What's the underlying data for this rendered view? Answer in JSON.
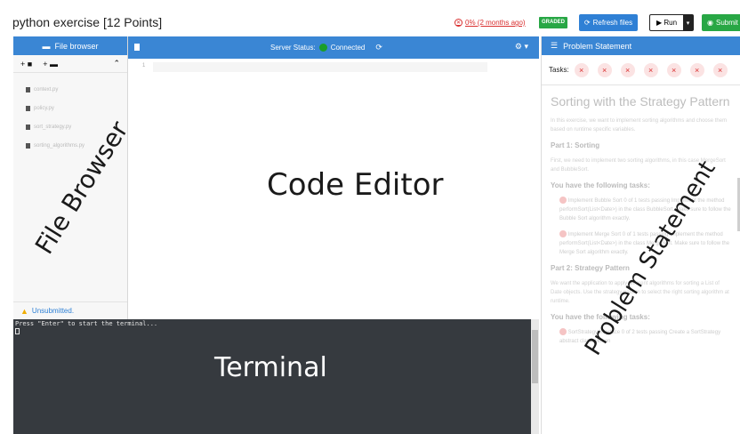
{
  "header": {
    "title": "python exercise",
    "points": "[12 Points]",
    "result_text": "0% (2 months ago)",
    "graded_badge": "GRADED",
    "refresh_label": "Refresh files",
    "run_label": "Run",
    "submit_label": "Submit"
  },
  "file_browser": {
    "title": "File browser",
    "add_file": "+",
    "add_folder": "+",
    "files": [
      "context.py",
      "policy.py",
      "sort_strategy.py",
      "sorting_algorithms.py"
    ],
    "status": "Unsubmitted."
  },
  "editor": {
    "server_status_label": "Server Status:",
    "connection": "Connected",
    "line_number": "1"
  },
  "terminal": {
    "prompt": "Press \"Enter\" to start the terminal..."
  },
  "problem": {
    "panel_title": "Problem Statement",
    "tasks_label": "Tasks:",
    "tasks": [
      "×",
      "×",
      "×",
      "×",
      "×",
      "×",
      "×"
    ],
    "heading": "Sorting with the Strategy Pattern",
    "intro": "In this exercise, we want to implement sorting algorithms and choose them based on runtime specific variables.",
    "part1": "Part 1: Sorting",
    "part1_text": "First, we need to implement two sorting algorithms, in this case MergeSort and BubbleSort.",
    "tasks_heading": "You have the following tasks:",
    "task1": "Implement Bubble Sort 0 of 1 tests passing Implement the method performSort(List<Date>) in the class BubbleSort. Make sure to follow the Bubble Sort algorithm exactly.",
    "task2": "Implement Merge Sort 0 of 1 tests passing Implement the method performSort(List<Date>) in the class MergeSort. Make sure to follow the Merge Sort algorithm exactly.",
    "part2": "Part 2: Strategy Pattern",
    "part2_text": "We want the application to apply different algorithms for sorting a List of Date objects. Use the strategy pattern to select the right sorting algorithm at runtime.",
    "tasks_heading2": "You have the following tasks:",
    "task3": "SortStrategy Interface 0 of 2 tests passing Create a SortStrategy abstract class with an"
  },
  "overlays": {
    "file_browser": "File Browser",
    "code_editor": "Code Editor",
    "terminal": "Terminal",
    "problem_statement": "Problem Statement"
  },
  "colors": {
    "accent": "#3a86d4",
    "success": "#28a745",
    "error": "#d93030",
    "terminal_bg": "#363a3f"
  }
}
